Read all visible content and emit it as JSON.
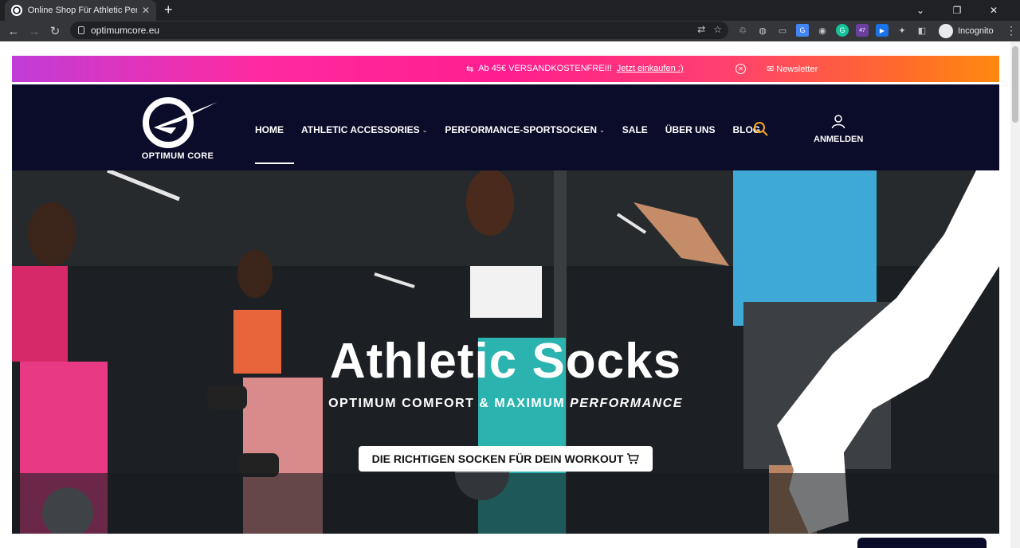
{
  "browser": {
    "tab_title": "Online Shop Für Athletic Perform",
    "url": "optimumcore.eu",
    "profile_label": "Incognito",
    "extension_badge": "47"
  },
  "announcement": {
    "shipping_text": "Ab 45€ VERSANDKOSTENFREI!!",
    "shop_link": "Jetzt einkaufen :)",
    "newsletter": "Newsletter"
  },
  "header": {
    "brand": "OPTIMUM CORE",
    "nav": [
      {
        "label": "HOME",
        "dropdown": false
      },
      {
        "label": "ATHLETIC ACCESSORIES",
        "dropdown": true
      },
      {
        "label": "PERFORMANCE-SPORTSOCKEN",
        "dropdown": true
      },
      {
        "label": "SALE",
        "dropdown": false
      },
      {
        "label": "ÜBER UNS",
        "dropdown": false
      },
      {
        "label": "BLOG",
        "dropdown": false
      }
    ],
    "login_label": "ANMELDEN"
  },
  "hero": {
    "title": "Athletic Socks",
    "subtitle_bold": "OPTIMUM COMFORT & MAXIMUM",
    "subtitle_italic": "PERFORMANCE",
    "cta": "DIE RICHTIGEN SOCKEN FÜR DEIN WORKOUT"
  },
  "colors": {
    "header_bg": "#0b0b2a",
    "search_icon": "#f5a623",
    "accent_start": "#c13dd8",
    "accent_end": "#ff8a10"
  }
}
